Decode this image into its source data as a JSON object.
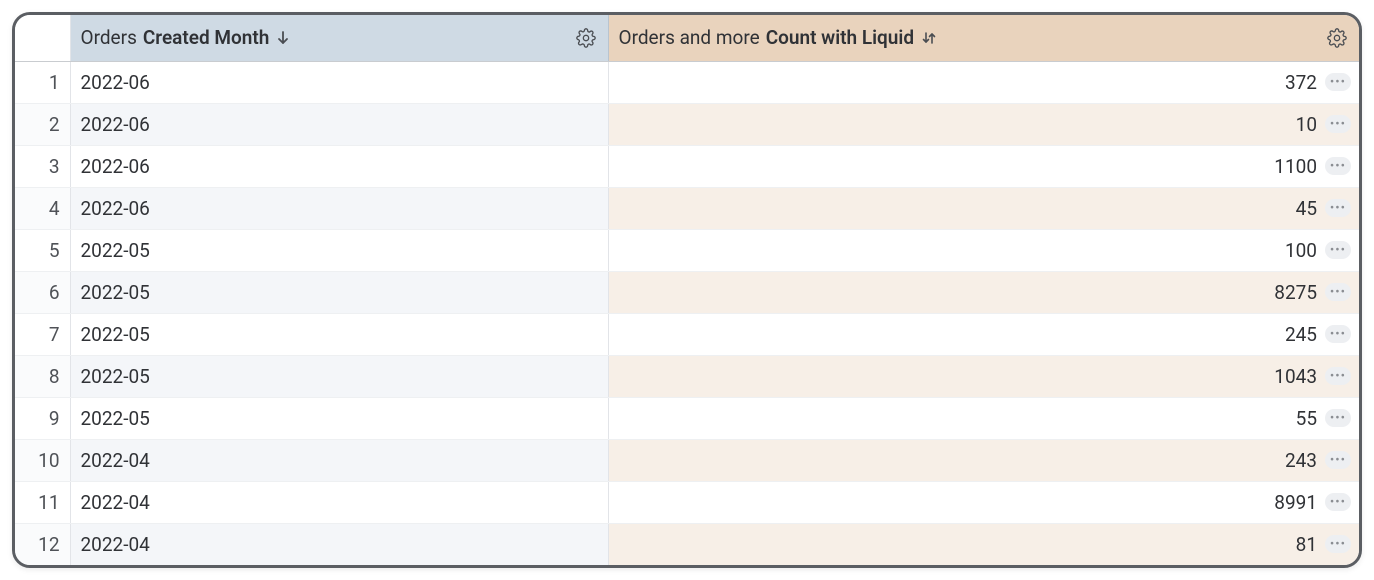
{
  "columns": {
    "dimension": {
      "prefix": "Orders ",
      "bold": "Created Month",
      "sort": "desc"
    },
    "measure": {
      "prefix": "Orders and more ",
      "bold": "Count with Liquid",
      "pivot_sort": true
    }
  },
  "rows": [
    {
      "n": "1",
      "month": "2022-06",
      "value": "372"
    },
    {
      "n": "2",
      "month": "2022-06",
      "value": "10"
    },
    {
      "n": "3",
      "month": "2022-06",
      "value": "1100"
    },
    {
      "n": "4",
      "month": "2022-06",
      "value": "45"
    },
    {
      "n": "5",
      "month": "2022-05",
      "value": "100"
    },
    {
      "n": "6",
      "month": "2022-05",
      "value": "8275"
    },
    {
      "n": "7",
      "month": "2022-05",
      "value": "245"
    },
    {
      "n": "8",
      "month": "2022-05",
      "value": "1043"
    },
    {
      "n": "9",
      "month": "2022-05",
      "value": "55"
    },
    {
      "n": "10",
      "month": "2022-04",
      "value": "243"
    },
    {
      "n": "11",
      "month": "2022-04",
      "value": "8991"
    },
    {
      "n": "12",
      "month": "2022-04",
      "value": "81"
    }
  ]
}
